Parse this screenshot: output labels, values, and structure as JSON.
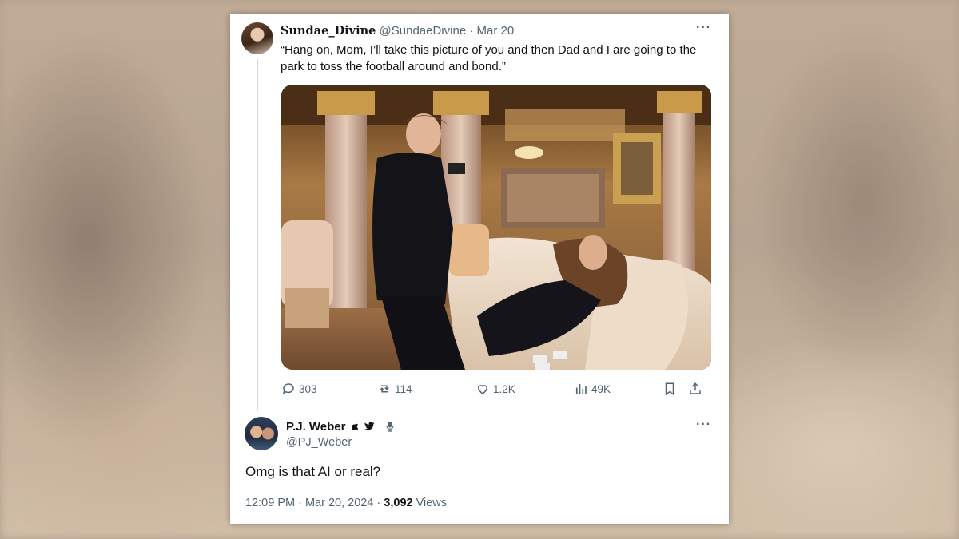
{
  "tweet1": {
    "display_name": "Sundae_Divine",
    "handle": "@SundaeDivine",
    "date": "Mar 20",
    "separator": "·",
    "more": "···",
    "text": "“Hang on, Mom, I’ll take this picture of you and then Dad and I are going to the park to toss the football around and bond.”",
    "actions": {
      "replies": "303",
      "retweets": "114",
      "likes": "1.2K",
      "views": "49K"
    }
  },
  "tweet2": {
    "display_name": "P.J. Weber",
    "handle": "@PJ_Weber",
    "more": "···",
    "text": "Omg is that AI or real?",
    "time": "12:09 PM · Mar 20, 2024 · ",
    "views_count": "3,092",
    "views_label": " Views"
  }
}
